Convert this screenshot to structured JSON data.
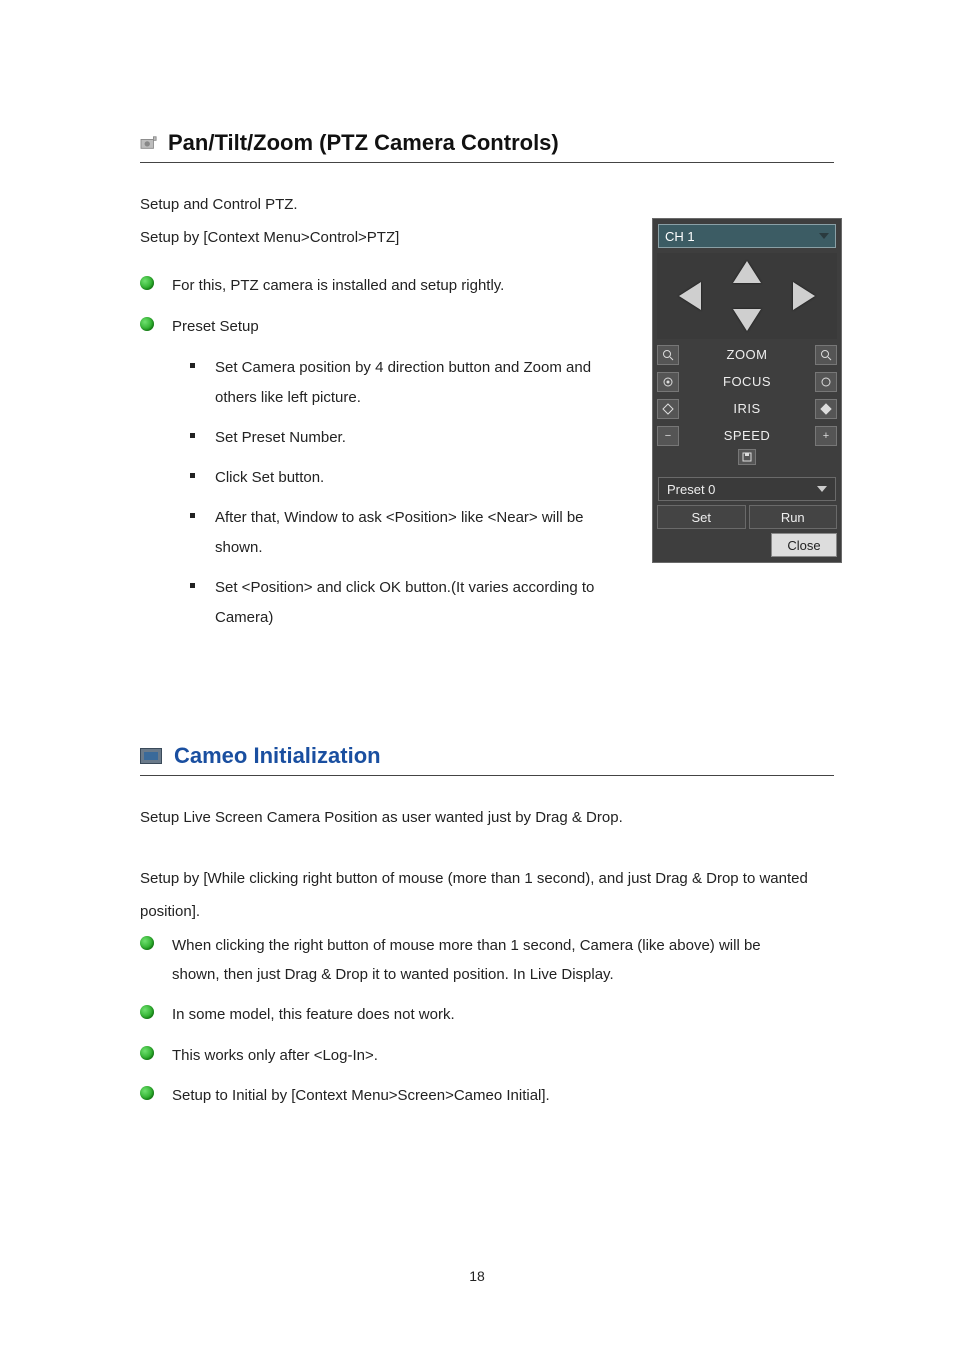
{
  "section1": {
    "title": "Pan/Tilt/Zoom (PTZ Camera Controls)",
    "intro1": "Setup and Control PTZ.",
    "intro2": "Setup by [Context Menu>Control>PTZ]",
    "bullets": [
      "For this, PTZ camera is installed and setup rightly.",
      "Preset Setup"
    ],
    "sublist": [
      "Set Camera position by 4 direction button and Zoom and others like left picture.",
      "Set Preset Number.",
      "Click Set button.",
      "After that, Window to ask <Position> like <Near> will be shown.",
      "Set <Position>  and click OK button.(It varies according to Camera)"
    ]
  },
  "ptz": {
    "channel": "CH 1",
    "rows": {
      "zoom": "ZOOM",
      "focus": "FOCUS",
      "iris": "IRIS",
      "speed": "SPEED"
    },
    "preset": "Preset 0",
    "set": "Set",
    "run": "Run",
    "close": "Close"
  },
  "section2": {
    "title": "Cameo Initialization",
    "intro1": "Setup Live Screen Camera Position as user wanted just by Drag & Drop.",
    "intro2": "Setup by [While clicking right button of mouse (more than 1 second), and just Drag & Drop to wanted position].",
    "bullets": [
      "When clicking the right button of mouse more than 1 second, Camera (like above) will be shown, then just Drag & Drop it to wanted position. In Live Display.",
      "In some model, this feature does not work.",
      "This works only after <Log-In>.",
      "Setup to Initial by [Context Menu>Screen>Cameo Initial]."
    ]
  },
  "page_number": "18"
}
